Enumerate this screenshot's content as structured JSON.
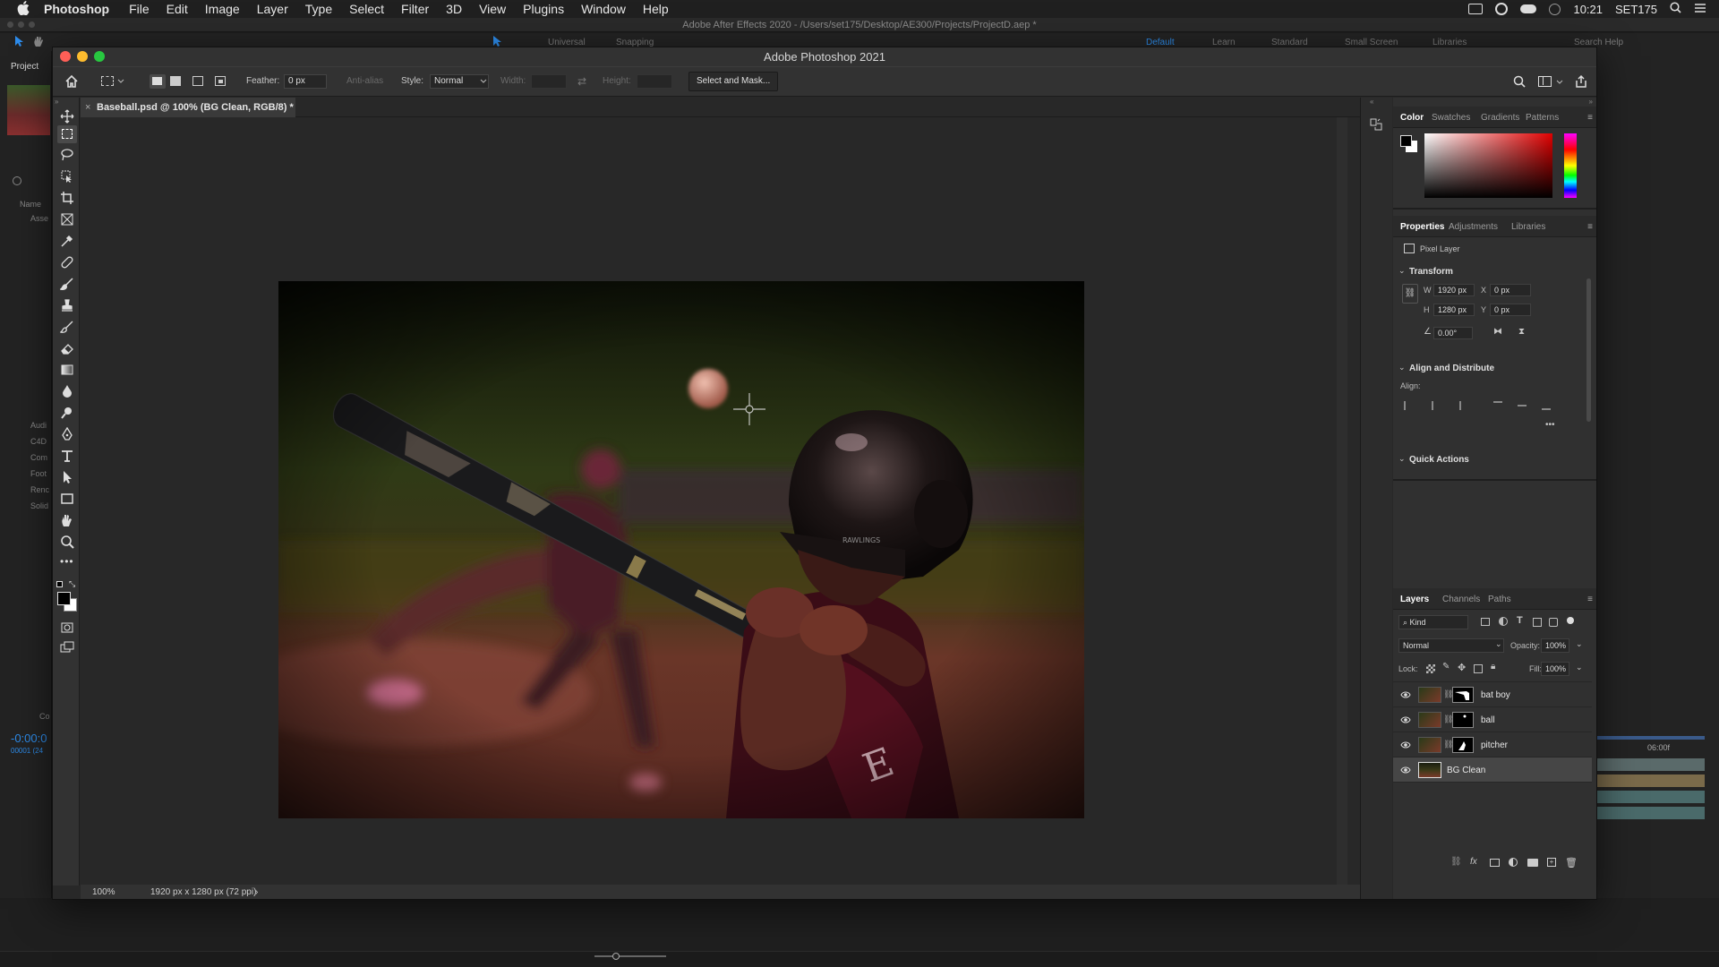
{
  "menubar": {
    "app_name": "Photoshop",
    "items": [
      "File",
      "Edit",
      "Image",
      "Layer",
      "Type",
      "Select",
      "Filter",
      "3D",
      "View",
      "Plugins",
      "Window",
      "Help"
    ],
    "clock": "10:21",
    "user": "SET175"
  },
  "after_effects": {
    "title": "Adobe After Effects 2020 - /Users/set175/Desktop/AE300/Projects/ProjectD.aep *",
    "toolbar": {
      "universal": "Universal",
      "snapping": "Snapping",
      "workspaces": [
        "Default",
        "Learn",
        "Standard",
        "Small Screen",
        "Libraries"
      ],
      "search_help": "Search Help"
    },
    "project_tab": "Project",
    "name_col": "Name",
    "folders": [
      "Asse",
      "Audi",
      "C4D",
      "Com",
      "Foot",
      "Renc",
      "Solid"
    ],
    "timecode": "-0:00:0",
    "frames": "00001 (24",
    "timeline_marker": "06:00f",
    "comp_label": "Co"
  },
  "photoshop": {
    "window_title": "Adobe Photoshop 2021",
    "options": {
      "feather_label": "Feather:",
      "feather_value": "0 px",
      "anti_alias": "Anti-alias",
      "style_label": "Style:",
      "style_value": "Normal",
      "width_label": "Width:",
      "height_label": "Height:",
      "select_mask_button": "Select and Mask..."
    },
    "document_tab": "Baseball.psd @ 100% (BG Clean, RGB/8) *",
    "status": {
      "zoom": "100%",
      "doc_info": "1920 px x 1280 px (72 ppi)"
    }
  },
  "color_panel": {
    "tabs": [
      "Color",
      "Swatches",
      "Gradients",
      "Patterns"
    ]
  },
  "properties_panel": {
    "tabs": [
      "Properties",
      "Adjustments",
      "Libraries"
    ],
    "layer_type": "Pixel Layer",
    "transform_title": "Transform",
    "w_label": "W",
    "w_value": "1920 px",
    "h_label": "H",
    "h_value": "1280 px",
    "x_label": "X",
    "x_value": "0 px",
    "y_label": "Y",
    "y_value": "0 px",
    "angle_value": "0.00°",
    "align_title": "Align and Distribute",
    "align_label": "Align:",
    "quick_actions_title": "Quick Actions"
  },
  "layers_panel": {
    "tabs": [
      "Layers",
      "Channels",
      "Paths"
    ],
    "filter_kind": "Kind",
    "blend_mode": "Normal",
    "opacity_label": "Opacity:",
    "opacity_value": "100%",
    "lock_label": "Lock:",
    "fill_label": "Fill:",
    "fill_value": "100%",
    "layers": [
      {
        "name": "bat boy"
      },
      {
        "name": "ball"
      },
      {
        "name": "pitcher"
      },
      {
        "name": "BG Clean"
      }
    ]
  },
  "colors": {
    "accent_blue": "#1473e6",
    "panel_bg": "#303030",
    "canvas_bg": "#282828"
  }
}
